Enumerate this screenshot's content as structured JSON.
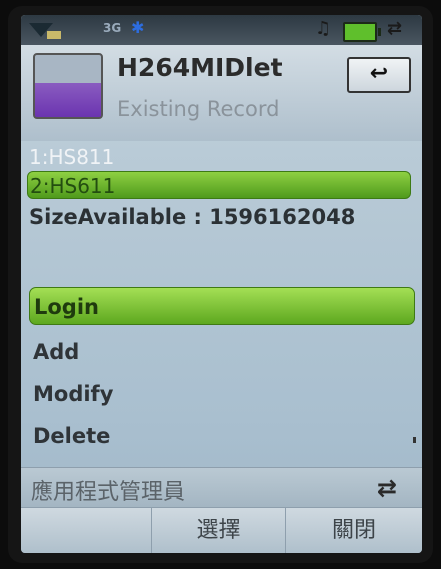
{
  "status": {
    "network": "3G"
  },
  "header": {
    "title": "H264MIDlet",
    "subtitle": "Existing Record"
  },
  "records": [
    {
      "label": "1:HS811",
      "selected": false
    },
    {
      "label": "2:HS611",
      "selected": true
    }
  ],
  "size_available": "SizeAvailable : 1596162048",
  "menu": [
    {
      "label": "Login",
      "selected": true
    },
    {
      "label": "Add",
      "selected": false
    },
    {
      "label": "Modify",
      "selected": false
    },
    {
      "label": "Delete",
      "selected": false
    }
  ],
  "manager_bar": {
    "label": "應用程式管理員"
  },
  "softkeys": {
    "left": "",
    "center": "選擇",
    "right": "關閉"
  },
  "icons": {
    "back": "back-arrow-icon",
    "sync": "sync-icon"
  }
}
